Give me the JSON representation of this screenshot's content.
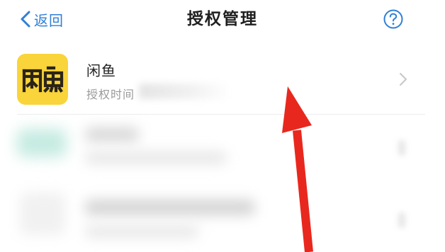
{
  "header": {
    "back_label": "返回",
    "title": "授权管理",
    "help_icon": "question-circle-icon"
  },
  "list": {
    "items": [
      {
        "app_name": "闲鱼",
        "app_icon_text": "闲鱼",
        "subtitle": "授权时间",
        "icon": "xianyu-app-icon"
      }
    ]
  },
  "colors": {
    "accent": "#2f7fd6",
    "xianyu_yellow": "#f9d43a",
    "annotation_red": "#e8281e"
  }
}
